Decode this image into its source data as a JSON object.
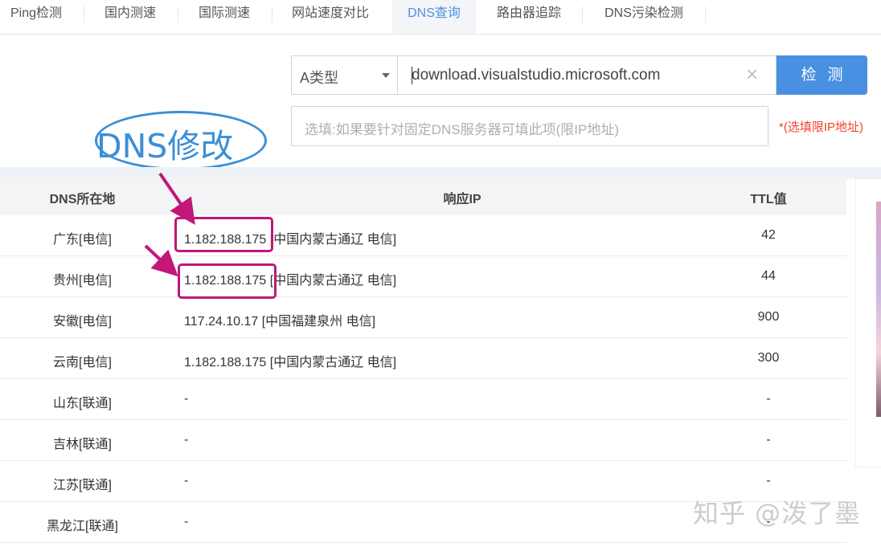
{
  "tabs": [
    {
      "label": "Ping检测"
    },
    {
      "label": "国内测速"
    },
    {
      "label": "国际测速"
    },
    {
      "label": "网站速度对比"
    },
    {
      "label": "DNS查询"
    },
    {
      "label": "路由器追踪"
    },
    {
      "label": "DNS污染检测"
    }
  ],
  "query": {
    "record_type": "A类型",
    "domain": "download.visualstudio.microsoft.com",
    "clear_icon": "×",
    "check_label": "检测",
    "dns_placeholder": "选填:如果要针对固定DNS服务器可填此项(限IP地址)",
    "dns_hint": "*(选填限IP地址)"
  },
  "annotation": {
    "label": "DNS修改",
    "color": "#3b8ed6",
    "highlight_color": "#c01778"
  },
  "table": {
    "headers": {
      "location": "DNS所在地",
      "ip": "响应IP",
      "ttl": "TTL值"
    },
    "rows": [
      {
        "location": "广东[电信]",
        "ip": "1.182.188.175",
        "region": "[中国内蒙古通辽 电信]",
        "ttl": "42"
      },
      {
        "location": "贵州[电信]",
        "ip": "1.182.188.175",
        "region": "[中国内蒙古通辽 电信]",
        "ttl": "44"
      },
      {
        "location": "安徽[电信]",
        "ip": "117.24.10.17",
        "region": "[中国福建泉州 电信]",
        "ttl": "900"
      },
      {
        "location": "云南[电信]",
        "ip": "1.182.188.175",
        "region": "[中国内蒙古通辽 电信]",
        "ttl": "300"
      },
      {
        "location": "山东[联通]",
        "ip": "-",
        "region": "",
        "ttl": "-"
      },
      {
        "location": "吉林[联通]",
        "ip": "-",
        "region": "",
        "ttl": "-"
      },
      {
        "location": "江苏[联通]",
        "ip": "-",
        "region": "",
        "ttl": "-"
      },
      {
        "location": "黑龙江[联通]",
        "ip": "-",
        "region": "",
        "ttl": "-"
      }
    ]
  },
  "watermark": "知乎 @泼了墨",
  "colors": {
    "accent": "#4a90e2",
    "hint_red": "#f0442c"
  }
}
